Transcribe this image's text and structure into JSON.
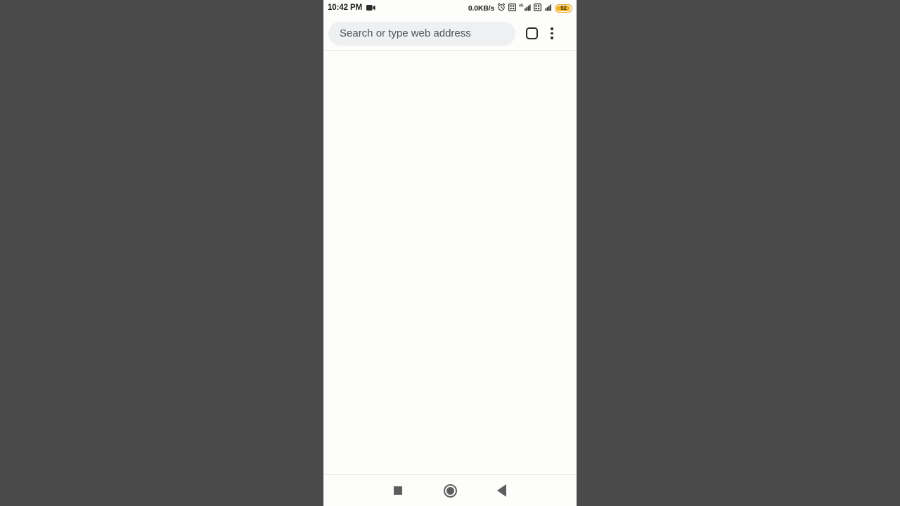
{
  "status_bar": {
    "clock": "10:42 PM",
    "recording_icon": "video-camera-icon",
    "network_speed": "0.0KB/s",
    "alarm_icon": "alarm-clock-icon",
    "sim1_icon": "sim-card-signal-icon",
    "sim1_network_label": "4G",
    "sim2_icon": "sim-card-signal-icon",
    "battery_level": "92",
    "battery_color": "#f0b429"
  },
  "browser": {
    "omnibox_placeholder": "Search or type web address",
    "omnibox_value": "",
    "tab_count_label": "",
    "tab_icon": "tab-switcher-icon",
    "menu_icon": "three-dot-menu-icon",
    "page_background": "#fdfdfb"
  },
  "nav_bar": {
    "recents_icon": "square-recents-icon",
    "home_icon": "circle-home-icon",
    "back_icon": "triangle-back-icon"
  },
  "theme": {
    "backdrop": "#4a4a4a",
    "surface": "#fdfdfb",
    "omnibox_background": "#eef0f1",
    "text_primary": "#1c1c1c",
    "text_secondary": "#4e5256",
    "nav_icon": "#5e5e5e"
  }
}
